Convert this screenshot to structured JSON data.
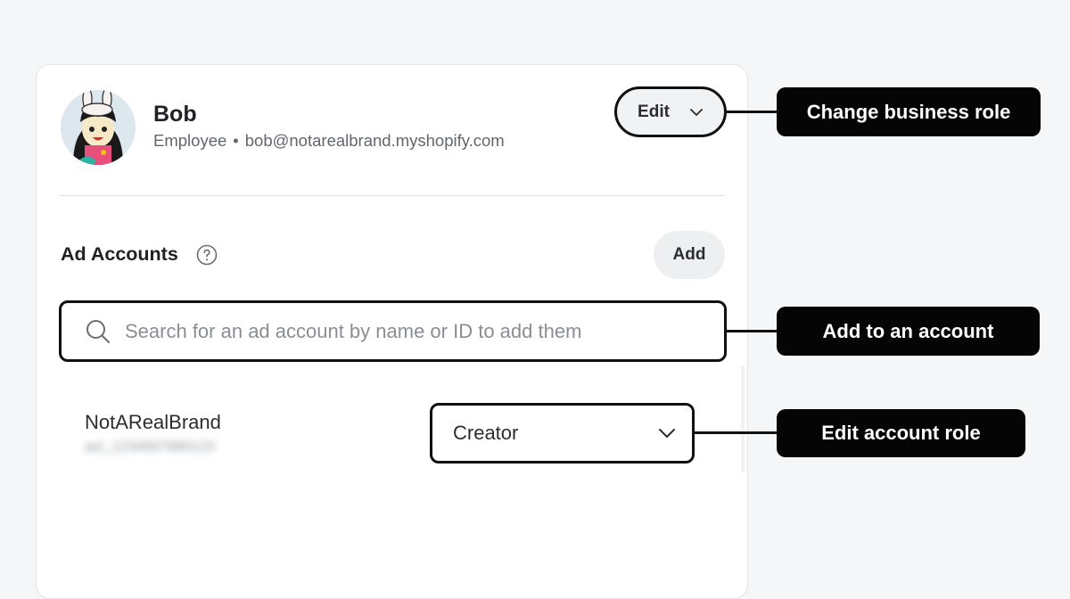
{
  "user": {
    "name": "Bob",
    "role": "Employee",
    "separator": "•",
    "email": "bob@notarealbrand.myshopify.com",
    "edit_label": "Edit"
  },
  "ad_accounts": {
    "title": "Ad Accounts",
    "add_label": "Add",
    "search_placeholder": "Search for an ad account by name or ID to add them",
    "search_value": "",
    "items": [
      {
        "name": "NotARealBrand",
        "id": "act_1234567890123",
        "role": "Creator"
      }
    ]
  },
  "callouts": {
    "change_business_role": "Change business role",
    "add_to_account": "Add to an account",
    "edit_account_role": "Edit account role"
  },
  "icons": {
    "help": "question-circle-icon",
    "search": "magnifier-icon",
    "chevron": "chevron-down-icon"
  },
  "colors": {
    "background": "#f5f6f7",
    "callout_background": "#050505",
    "highlight_border": "#111111"
  }
}
